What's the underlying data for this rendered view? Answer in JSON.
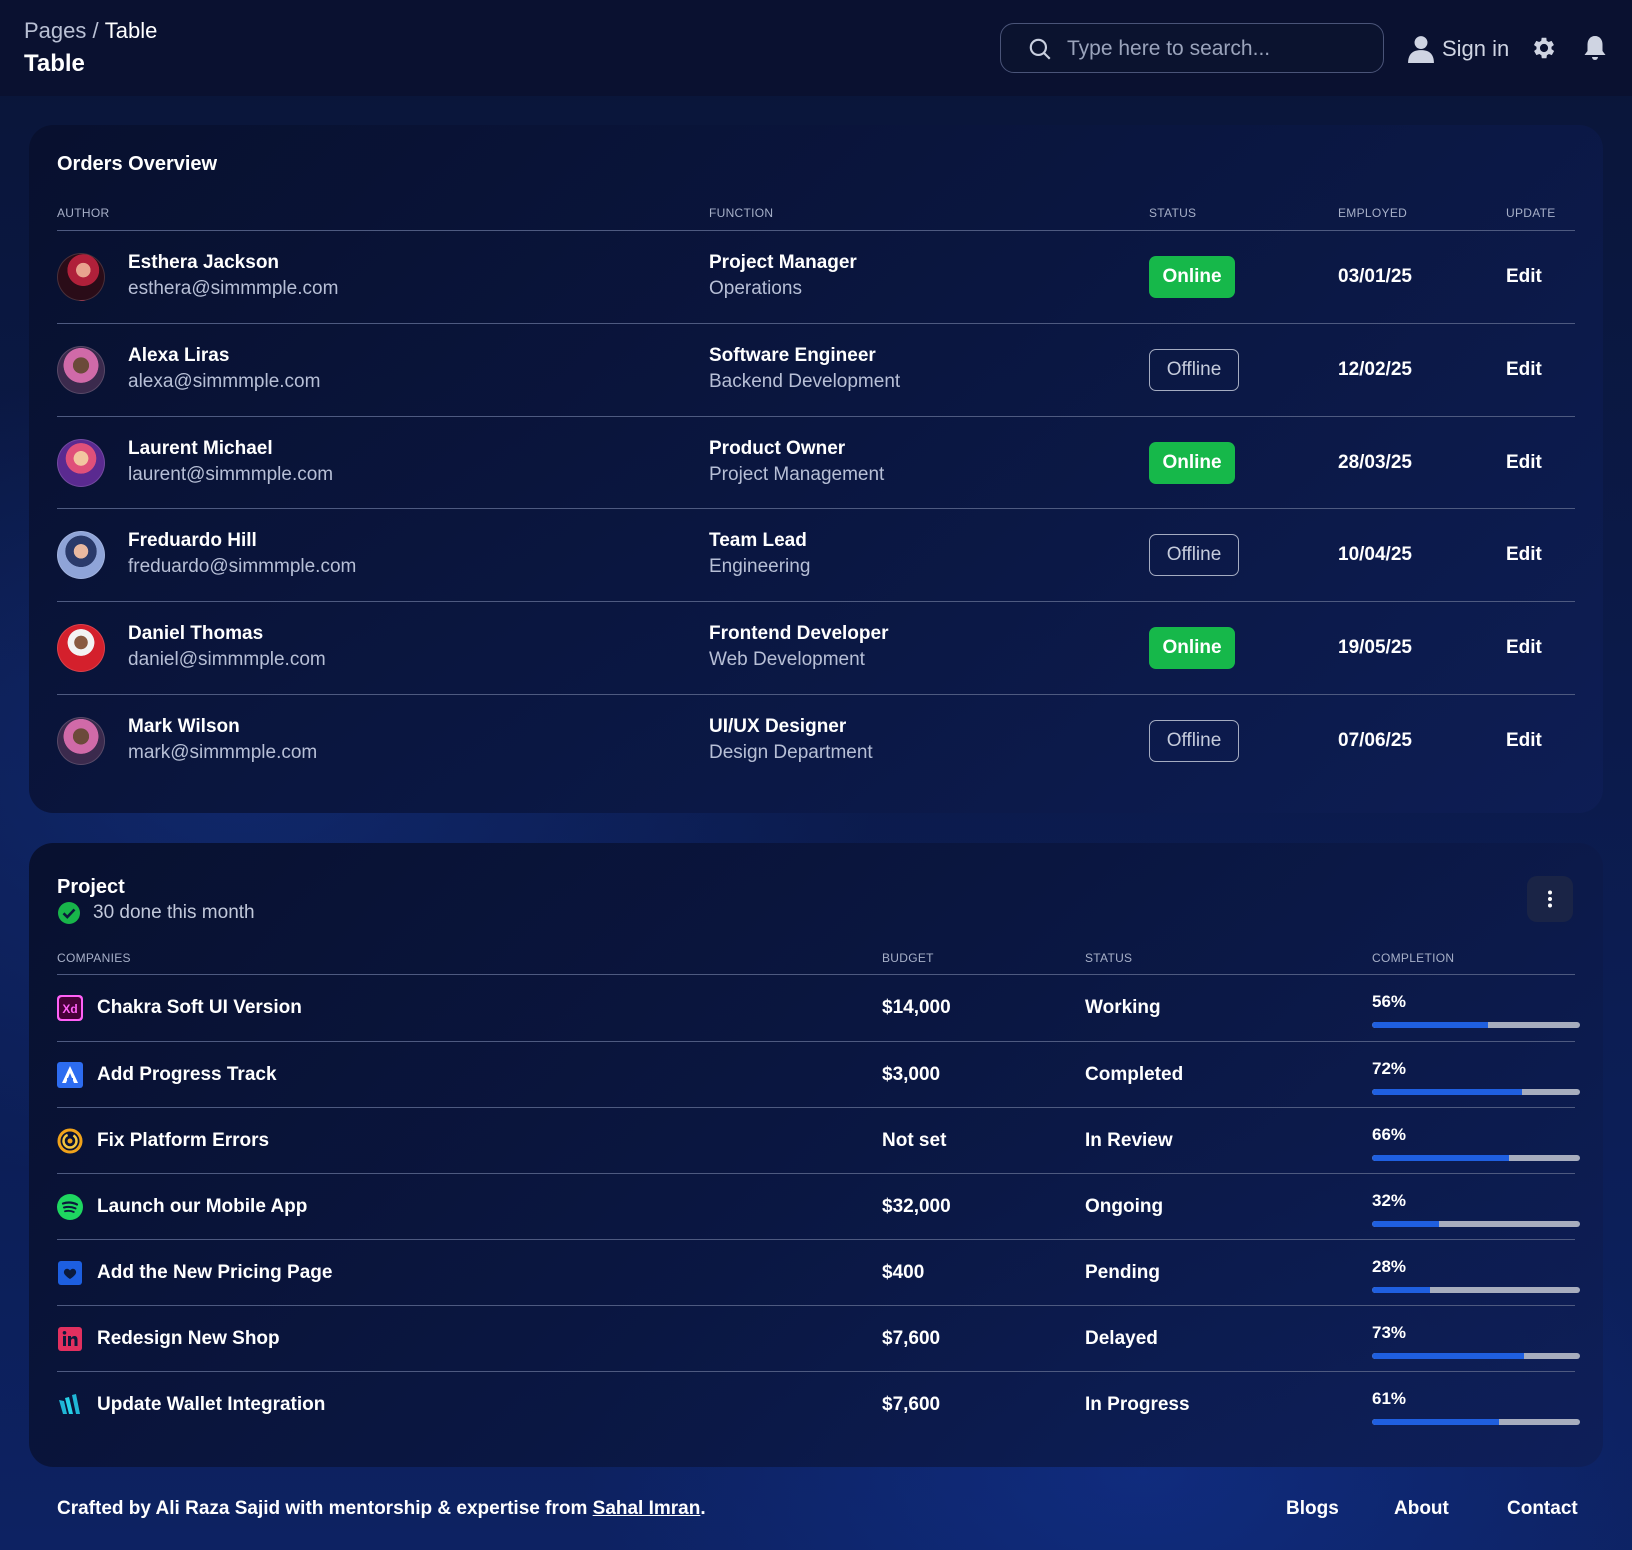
{
  "header": {
    "breadcrumb_parent": "Pages",
    "breadcrumb_separator": "/",
    "breadcrumb_current": "Table",
    "page_title": "Table",
    "search_placeholder": "Type here to search...",
    "sign_in_label": "Sign in"
  },
  "orders": {
    "title": "Orders Overview",
    "columns": [
      "AUTHOR",
      "FUNCTION",
      "STATUS",
      "EMPLOYED",
      "UPDATE"
    ],
    "rows": [
      {
        "name": "Esthera Jackson",
        "email": "esthera@simmmple.com",
        "role": "Project Manager",
        "dept": "Operations",
        "status": "Online",
        "employed": "03/01/25",
        "action": "Edit"
      },
      {
        "name": "Alexa Liras",
        "email": "alexa@simmmple.com",
        "role": "Software Engineer",
        "dept": "Backend Development",
        "status": "Offline",
        "employed": "12/02/25",
        "action": "Edit"
      },
      {
        "name": "Laurent Michael",
        "email": "laurent@simmmple.com",
        "role": "Product Owner",
        "dept": "Project Management",
        "status": "Online",
        "employed": "28/03/25",
        "action": "Edit"
      },
      {
        "name": "Freduardo Hill",
        "email": "freduardo@simmmple.com",
        "role": "Team Lead",
        "dept": "Engineering",
        "status": "Offline",
        "employed": "10/04/25",
        "action": "Edit"
      },
      {
        "name": "Daniel Thomas",
        "email": "daniel@simmmple.com",
        "role": "Frontend Developer",
        "dept": "Web Development",
        "status": "Online",
        "employed": "19/05/25",
        "action": "Edit"
      },
      {
        "name": "Mark Wilson",
        "email": "mark@simmmple.com",
        "role": "UI/UX Designer",
        "dept": "Design Department",
        "status": "Offline",
        "employed": "07/06/25",
        "action": "Edit"
      }
    ]
  },
  "projects": {
    "title": "Project",
    "subtitle": "30 done this month",
    "columns": [
      "COMPANIES",
      "BUDGET",
      "STATUS",
      "COMPLETION"
    ],
    "rows": [
      {
        "company": "Chakra Soft UI Version",
        "icon": "adobe-xd-icon",
        "budget": "$14,000",
        "status": "Working",
        "completion": "56%",
        "completion_value": 56
      },
      {
        "company": "Add Progress Track",
        "icon": "atlassian-icon",
        "budget": "$3,000",
        "status": "Completed",
        "completion": "72%",
        "completion_value": 72
      },
      {
        "company": "Fix Platform Errors",
        "icon": "swirl-icon",
        "budget": "Not set",
        "status": "In Review",
        "completion": "66%",
        "completion_value": 66
      },
      {
        "company": "Launch our Mobile App",
        "icon": "spotify-icon",
        "budget": "$32,000",
        "status": "Ongoing",
        "completion": "32%",
        "completion_value": 32
      },
      {
        "company": "Add the New Pricing Page",
        "icon": "heart-badge-icon",
        "budget": "$400",
        "status": "Pending",
        "completion": "28%",
        "completion_value": 28
      },
      {
        "company": "Redesign New Shop",
        "icon": "invision-icon",
        "budget": "$7,600",
        "status": "Delayed",
        "completion": "73%",
        "completion_value": 73
      },
      {
        "company": "Update Wallet Integration",
        "icon": "wallet-logo-icon",
        "budget": "$7,600",
        "status": "In Progress",
        "completion": "61%",
        "completion_value": 61
      }
    ]
  },
  "footer": {
    "credit_prefix": "Crafted by Ali Raza Sajid with mentorship & expertise from ",
    "credit_link": "Sahal Imran",
    "credit_suffix": ".",
    "links": [
      "Blogs",
      "About",
      "Contact"
    ]
  },
  "colors": {
    "online": "#16b84a",
    "progress_fill": "#1f5fe0",
    "progress_track": "#a7adbe",
    "background": "#0b1a4a"
  }
}
